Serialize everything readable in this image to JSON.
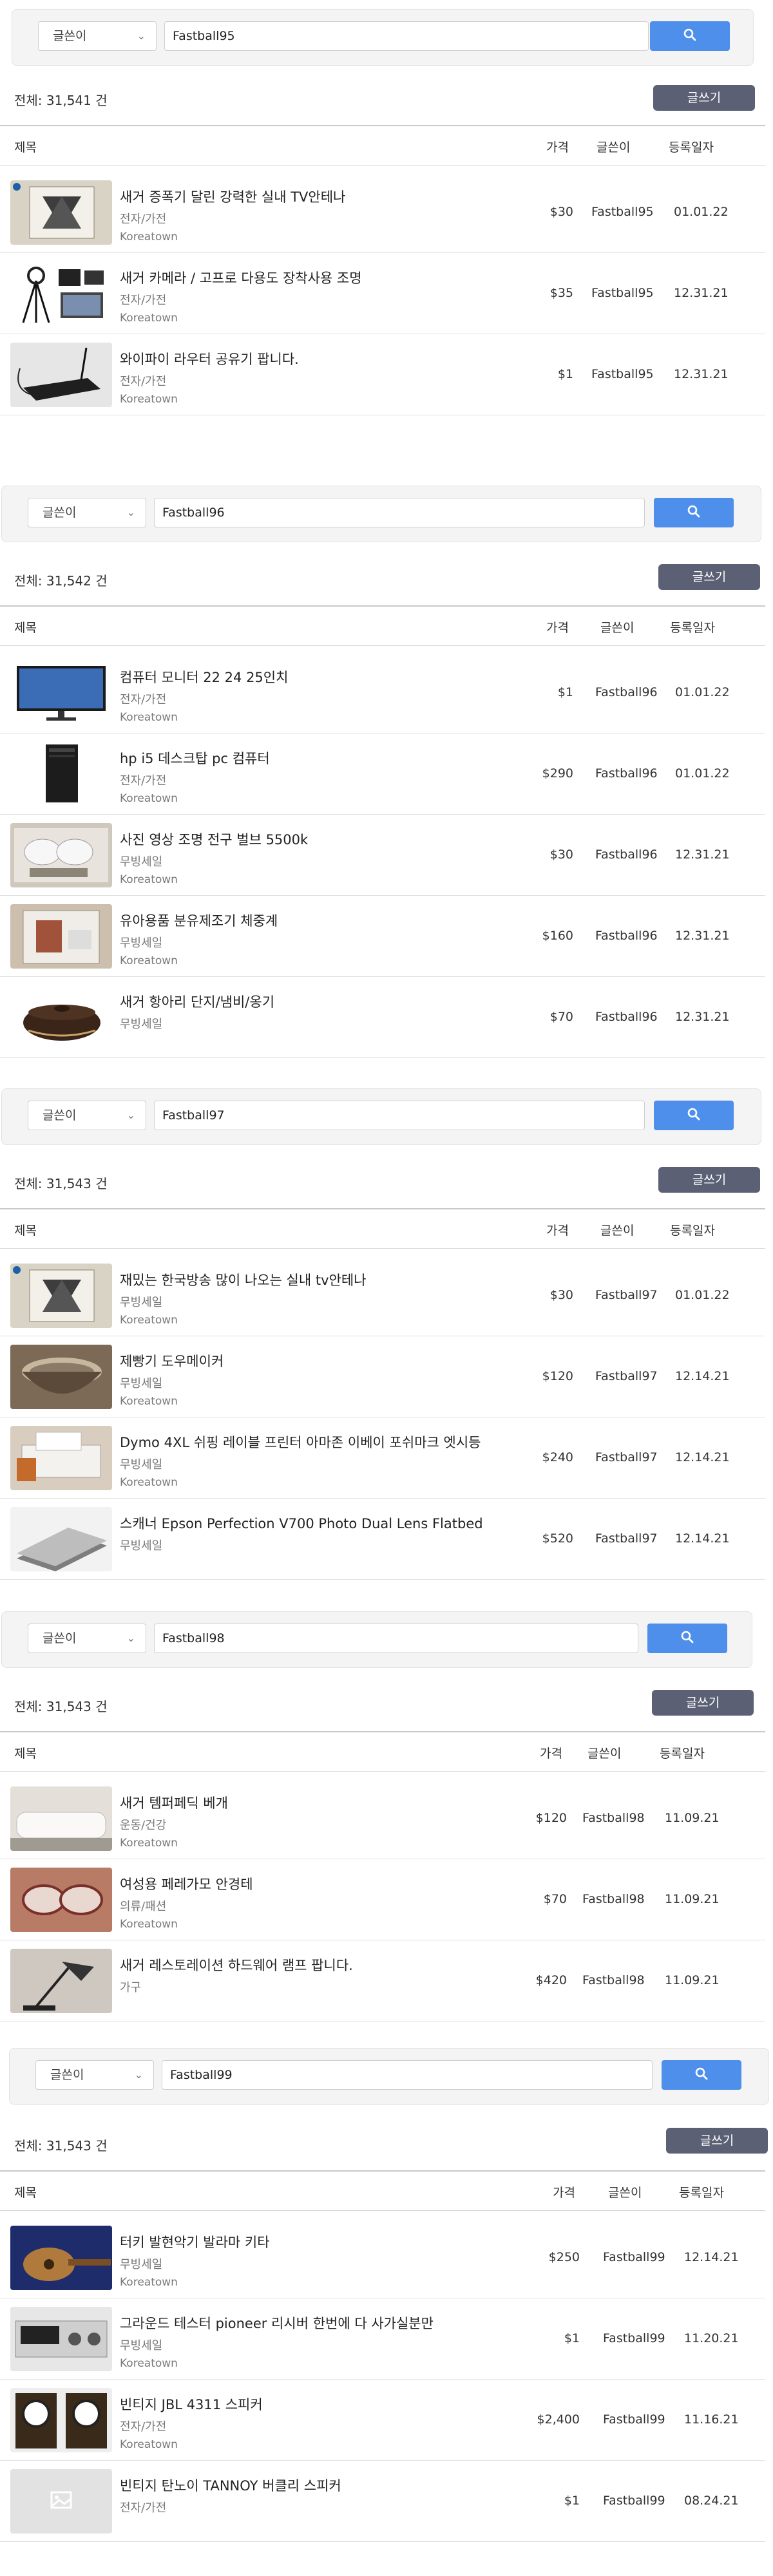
{
  "labels": {
    "selector": "글쓴이",
    "write_button": "글쓰기",
    "col_title": "제목",
    "col_price": "가격",
    "col_author": "글쓴이",
    "col_date": "등록일자"
  },
  "sections": [
    {
      "search_value": "Fastball95",
      "total": "전체: 31,541 건",
      "rows": [
        {
          "title": "새거 증폭기 달린 강력한 실내 TV안테나",
          "category": "전자/가전",
          "location": "Koreatown",
          "price": "$30",
          "author": "Fastball95",
          "date": "01.01.22"
        },
        {
          "title": "새거 카메라 / 고프로 다용도 장착사용 조명",
          "category": "전자/가전",
          "location": "Koreatown",
          "price": "$35",
          "author": "Fastball95",
          "date": "12.31.21"
        },
        {
          "title": "와이파이 라우터 공유기 팝니다.",
          "category": "전자/가전",
          "location": "Koreatown",
          "price": "$1",
          "author": "Fastball95",
          "date": "12.31.21"
        }
      ]
    },
    {
      "search_value": "Fastball96",
      "total": "전체: 31,542 건",
      "rows": [
        {
          "title": "컴퓨터 모니터 22 24 25인치",
          "category": "전자/가전",
          "location": "Koreatown",
          "price": "$1",
          "author": "Fastball96",
          "date": "01.01.22"
        },
        {
          "title": "hp i5 데스크탑 pc 컴퓨터",
          "category": "전자/가전",
          "location": "Koreatown",
          "price": "$290",
          "author": "Fastball96",
          "date": "01.01.22"
        },
        {
          "title": "사진 영상 조명 전구 벌브 5500k",
          "category": "무빙세일",
          "location": "Koreatown",
          "price": "$30",
          "author": "Fastball96",
          "date": "12.31.21"
        },
        {
          "title": "유아용품 분유제조기 체중계",
          "category": "무빙세일",
          "location": "Koreatown",
          "price": "$160",
          "author": "Fastball96",
          "date": "12.31.21"
        },
        {
          "title": "새거 항아리 단지/냄비/옹기",
          "category": "무빙세일",
          "location": "",
          "price": "$70",
          "author": "Fastball96",
          "date": "12.31.21"
        }
      ]
    },
    {
      "search_value": "Fastball97",
      "total": "전체: 31,543 건",
      "rows": [
        {
          "title": "재밌는 한국방송 많이 나오는 실내 tv안테나",
          "category": "무빙세일",
          "location": "Koreatown",
          "price": "$30",
          "author": "Fastball97",
          "date": "01.01.22"
        },
        {
          "title": "제빵기 도우메이커",
          "category": "무빙세일",
          "location": "Koreatown",
          "price": "$120",
          "author": "Fastball97",
          "date": "12.14.21"
        },
        {
          "title": "Dymo 4XL 쉬핑 레이블 프린터 아마존 이베이 포쉬마크 엣시등",
          "category": "무빙세일",
          "location": "Koreatown",
          "price": "$240",
          "author": "Fastball97",
          "date": "12.14.21"
        },
        {
          "title": "스캐너 Epson Perfection V700 Photo Dual Lens Flatbed",
          "category": "무빙세일",
          "location": "",
          "price": "$520",
          "author": "Fastball97",
          "date": "12.14.21"
        }
      ]
    },
    {
      "search_value": "Fastball98",
      "total": "전체: 31,543 건",
      "rows": [
        {
          "title": "새거 템퍼페딕 베개",
          "category": "운동/건강",
          "location": "Koreatown",
          "price": "$120",
          "author": "Fastball98",
          "date": "11.09.21"
        },
        {
          "title": "여성용 페레가모 안경테",
          "category": "의류/패션",
          "location": "Koreatown",
          "price": "$70",
          "author": "Fastball98",
          "date": "11.09.21"
        },
        {
          "title": "새거 레스토레이션 하드웨어 램프 팝니다.",
          "category": "가구",
          "location": "",
          "price": "$420",
          "author": "Fastball98",
          "date": "11.09.21"
        }
      ]
    },
    {
      "search_value": "Fastball99",
      "total": "전체: 31,543 건",
      "rows": [
        {
          "title": "터키 발현악기 발라마 키타",
          "category": "무빙세일",
          "location": "Koreatown",
          "price": "$250",
          "author": "Fastball99",
          "date": "12.14.21"
        },
        {
          "title": "그라운드 테스터 pioneer 리시버 한번에 다 사가실분만",
          "category": "무빙세일",
          "location": "Koreatown",
          "price": "$1",
          "author": "Fastball99",
          "date": "11.20.21"
        },
        {
          "title": "빈티지 JBL 4311 스피커",
          "category": "전자/가전",
          "location": "Koreatown",
          "price": "$2,400",
          "author": "Fastball99",
          "date": "11.16.21"
        },
        {
          "title": "빈티지 탄노이 TANNOY 버클리 스피커",
          "category": "전자/가전",
          "location": "",
          "price": "$1",
          "author": "Fastball99",
          "date": "08.24.21"
        }
      ]
    }
  ],
  "thumbnails": [
    [
      "antenna",
      "tripod",
      "router"
    ],
    [
      "monitor",
      "desktop",
      "bulbs",
      "box",
      "pot"
    ],
    [
      "antenna",
      "bowl",
      "printer",
      "scanner"
    ],
    [
      "pillow",
      "glasses",
      "lamp"
    ],
    [
      "guitar",
      "receiver",
      "speakers",
      "placeholder"
    ]
  ]
}
